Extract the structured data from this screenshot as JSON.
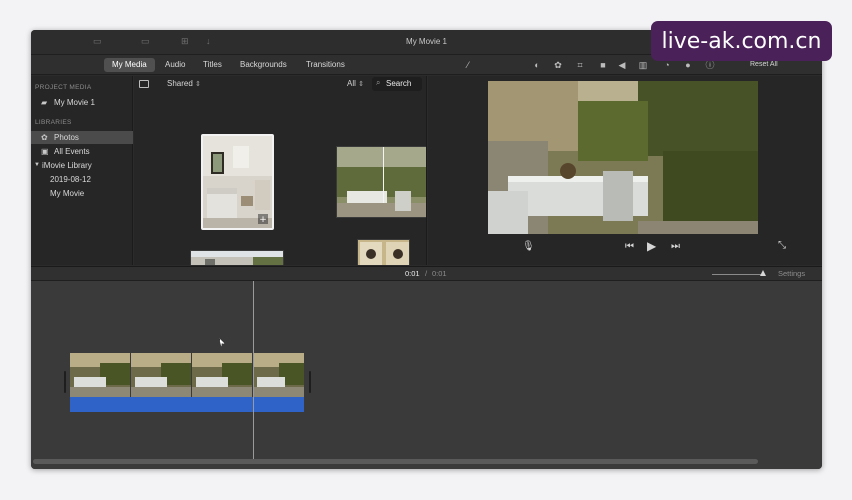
{
  "window": {
    "title": "My Movie 1"
  },
  "toolbar": {
    "tabs": [
      {
        "label": "My Media",
        "active": true
      },
      {
        "label": "Audio"
      },
      {
        "label": "Titles"
      },
      {
        "label": "Backgrounds"
      },
      {
        "label": "Transitions"
      }
    ],
    "reset_label": "Reset All"
  },
  "sidebar": {
    "project_header": "PROJECT MEDIA",
    "project_item": "My Movie 1",
    "libraries_header": "LIBRARIES",
    "items": [
      {
        "label": "Photos",
        "selected": true
      },
      {
        "label": "All Events"
      },
      {
        "label": "iMovie Library"
      },
      {
        "label": "2019-08-12"
      },
      {
        "label": "My Movie"
      }
    ]
  },
  "browser": {
    "filter": "Shared",
    "scope": "All",
    "search_placeholder": "Search"
  },
  "timeline": {
    "current_time": "0:01",
    "separator": "/",
    "total_time": "0:01",
    "settings_label": "Settings"
  },
  "watermark": "live-ak.com.cn",
  "colors": {
    "audio_track": "#2f63c8",
    "selection": "#4b4b4b"
  }
}
